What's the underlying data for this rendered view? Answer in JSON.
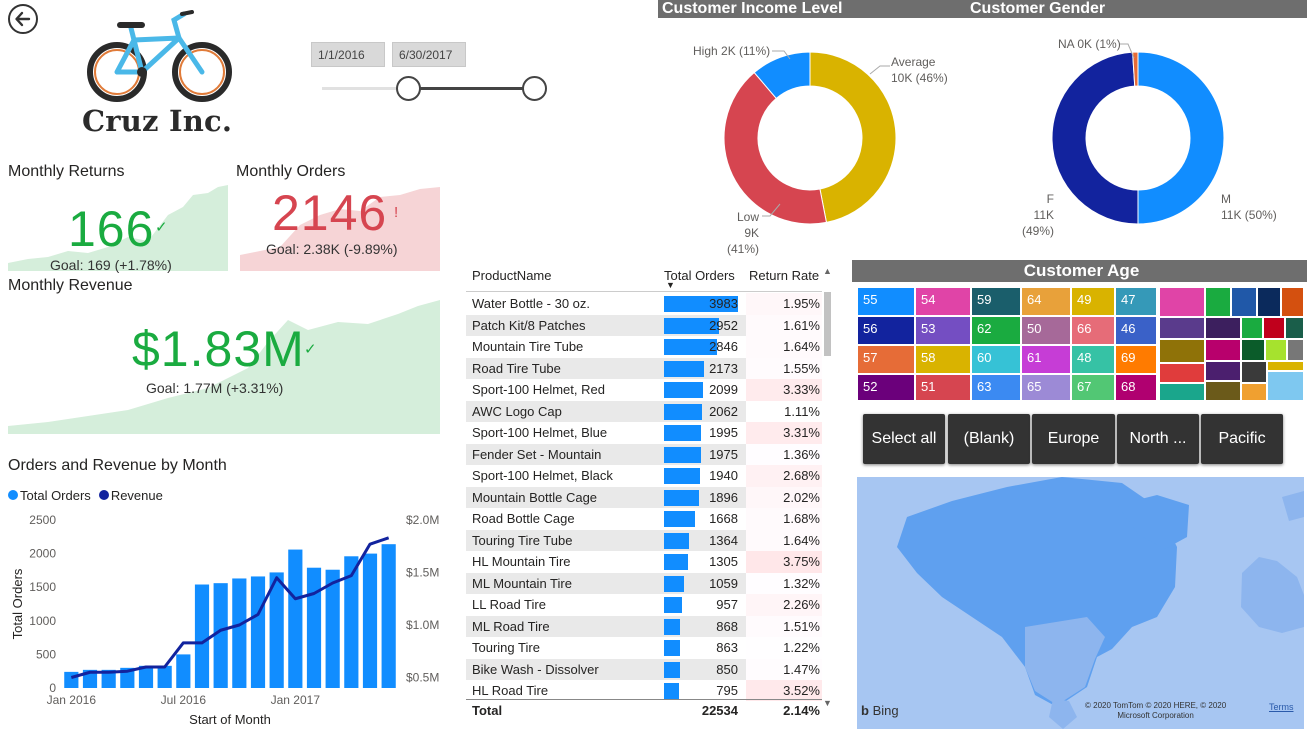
{
  "brand": {
    "name": "Cruz Inc."
  },
  "date_slicer": {
    "start": "1/1/2016",
    "end": "6/30/2017"
  },
  "kpis": {
    "returns": {
      "title": "Monthly Returns",
      "value": "166",
      "goal": "Goal: 169 (+1.78%)",
      "status_glyph": "✓",
      "color": "#1aab40"
    },
    "orders": {
      "title": "Monthly Orders",
      "value": "2146",
      "goal": "Goal: 2.38K (-9.89%)",
      "status_glyph": "!",
      "color": "#d64550"
    },
    "revenue": {
      "title": "Monthly Revenue",
      "value": "$1.83M",
      "goal": "Goal: 1.77M (+3.31%)",
      "status_glyph": "✓",
      "color": "#1aab40"
    }
  },
  "income_panel": {
    "title": "Customer Income Level",
    "labels": {
      "high": "High 2K (11%)",
      "average_1": "Average",
      "average_2": "10K (46%)",
      "low_1": "Low",
      "low_2": "9K (41%)"
    }
  },
  "gender_panel": {
    "title": "Customer Gender",
    "labels": {
      "na": "NA 0K (1%)",
      "f_1": "F",
      "f_2": "11K (49%)",
      "m_1": "M",
      "m_2": "11K (50%)"
    }
  },
  "age_panel": {
    "title": "Customer Age",
    "tiles": [
      "55",
      "54",
      "59",
      "64",
      "49",
      "47",
      "56",
      "53",
      "62",
      "50",
      "66",
      "46",
      "57",
      "58",
      "60",
      "61",
      "48",
      "69",
      "52",
      "51",
      "63",
      "65",
      "67",
      "68"
    ]
  },
  "region_slicer": {
    "buttons": [
      "Select all",
      "(Blank)",
      "Europe",
      "North ...",
      "Pacific"
    ]
  },
  "map": {
    "provider": "Bing",
    "copyright_1": "© 2020 TomTom © 2020 HERE, © 2020",
    "copyright_2": "Microsoft Corporation",
    "terms": "Terms"
  },
  "table": {
    "headers": {
      "name": "ProductName",
      "orders": "Total Orders",
      "rate": "Return Rate"
    },
    "rows": [
      {
        "name": "Water Bottle - 30 oz.",
        "orders": "3983",
        "rate": "1.95%"
      },
      {
        "name": "Patch Kit/8 Patches",
        "orders": "2952",
        "rate": "1.61%"
      },
      {
        "name": "Mountain Tire Tube",
        "orders": "2846",
        "rate": "1.64%"
      },
      {
        "name": "Road Tire Tube",
        "orders": "2173",
        "rate": "1.55%"
      },
      {
        "name": "Sport-100 Helmet, Red",
        "orders": "2099",
        "rate": "3.33%"
      },
      {
        "name": "AWC Logo Cap",
        "orders": "2062",
        "rate": "1.11%"
      },
      {
        "name": "Sport-100 Helmet, Blue",
        "orders": "1995",
        "rate": "3.31%"
      },
      {
        "name": "Fender Set - Mountain",
        "orders": "1975",
        "rate": "1.36%"
      },
      {
        "name": "Sport-100 Helmet, Black",
        "orders": "1940",
        "rate": "2.68%"
      },
      {
        "name": "Mountain Bottle Cage",
        "orders": "1896",
        "rate": "2.02%"
      },
      {
        "name": "Road Bottle Cage",
        "orders": "1668",
        "rate": "1.68%"
      },
      {
        "name": "Touring Tire Tube",
        "orders": "1364",
        "rate": "1.64%"
      },
      {
        "name": "HL Mountain Tire",
        "orders": "1305",
        "rate": "3.75%"
      },
      {
        "name": "ML Mountain Tire",
        "orders": "1059",
        "rate": "1.32%"
      },
      {
        "name": "LL Road Tire",
        "orders": "957",
        "rate": "2.26%"
      },
      {
        "name": "ML Road Tire",
        "orders": "868",
        "rate": "1.51%"
      },
      {
        "name": "Touring Tire",
        "orders": "863",
        "rate": "1.22%"
      },
      {
        "name": "Bike Wash - Dissolver",
        "orders": "850",
        "rate": "1.47%"
      },
      {
        "name": "HL Road Tire",
        "orders": "795",
        "rate": "3.52%"
      }
    ],
    "total": {
      "label": "Total",
      "orders": "22534",
      "rate": "2.14%"
    }
  },
  "chart_data": [
    {
      "type": "pie",
      "title": "Customer Income Level",
      "categories": [
        "Average",
        "Low",
        "High"
      ],
      "values": [
        46,
        41,
        11
      ],
      "colors": [
        "#d9b300",
        "#d64550",
        "#118dff"
      ]
    },
    {
      "type": "pie",
      "title": "Customer Gender",
      "categories": [
        "M",
        "F",
        "NA"
      ],
      "values": [
        50,
        49,
        1
      ],
      "colors": [
        "#118dff",
        "#12239e",
        "#e66c37"
      ]
    },
    {
      "type": "bar",
      "title": "Orders and Revenue by Month",
      "xlabel": "Start of Month",
      "ylabel": "Total Orders",
      "x_ticks": [
        "Jan 2016",
        "Jul 2016",
        "Jan 2017"
      ],
      "y_ticks": [
        "0",
        "500",
        "1000",
        "1500",
        "2000",
        "2500"
      ],
      "y2_ticks": [
        "$0.5M",
        "$1.0M",
        "$1.5M",
        "$2.0M"
      ],
      "ylim": [
        0,
        2500
      ],
      "y2lim": [
        0.4,
        2.0
      ],
      "categories": [
        "2016-01",
        "2016-02",
        "2016-03",
        "2016-04",
        "2016-05",
        "2016-06",
        "2016-07",
        "2016-08",
        "2016-09",
        "2016-10",
        "2016-11",
        "2016-12",
        "2017-01",
        "2017-02",
        "2017-03",
        "2017-04",
        "2017-05",
        "2017-06"
      ],
      "series": [
        {
          "name": "Total Orders",
          "kind": "bar",
          "color": "#118dff",
          "values": [
            240,
            270,
            270,
            300,
            330,
            330,
            500,
            1540,
            1560,
            1630,
            1660,
            1720,
            2060,
            1790,
            1760,
            1960,
            2000,
            2140
          ]
        },
        {
          "name": "Revenue",
          "kind": "line",
          "axis": "right",
          "color": "#12239e",
          "values": [
            0.5,
            0.55,
            0.55,
            0.56,
            0.6,
            0.6,
            0.83,
            0.83,
            0.95,
            1.0,
            1.1,
            1.45,
            1.25,
            1.3,
            1.4,
            1.47,
            1.77,
            1.83
          ]
        }
      ],
      "legend": "top-left"
    }
  ]
}
